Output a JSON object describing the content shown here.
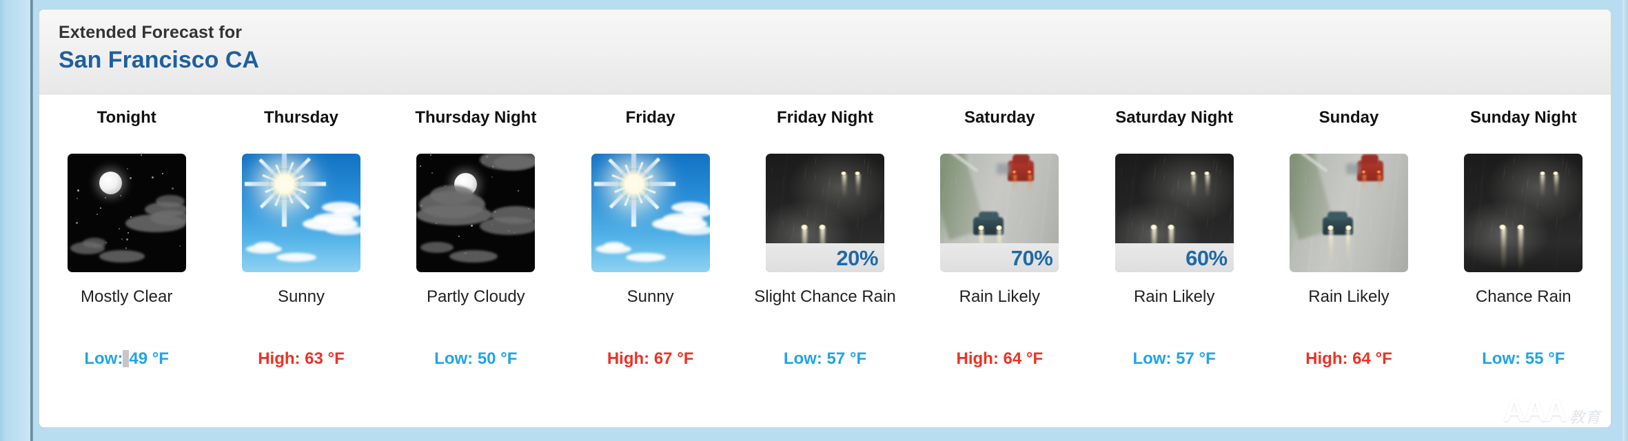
{
  "page": {
    "background_color": "#b8dcf0",
    "card_background": "#ffffff"
  },
  "header": {
    "eyebrow": "Extended Forecast for",
    "location": "San Francisco CA",
    "location_color": "#1f5f9e"
  },
  "colors": {
    "low_temp": "#1fa4e8",
    "high_temp": "#ee3124",
    "pop_badge": "#1f6aa5"
  },
  "watermark": {
    "text": "AAA",
    "subtext": "教育"
  },
  "forecast": [
    {
      "day": "Tonight",
      "icon": "moon-mostly-clear-icon",
      "icon_kind": "night-clear",
      "pop": null,
      "condition": "Mostly Clear",
      "temp_type": "Low",
      "temp_label": "Low:",
      "temp_value": "49 °F",
      "temp_full": "Low: 49 °F",
      "has_caret": true
    },
    {
      "day": "Thursday",
      "icon": "sun-sunny-icon",
      "icon_kind": "day-sunny",
      "pop": null,
      "condition": "Sunny",
      "temp_type": "High",
      "temp_label": "High:",
      "temp_value": "63 °F",
      "temp_full": "High: 63 °F",
      "has_caret": false
    },
    {
      "day": "Thursday Night",
      "icon": "moon-partly-cloudy-icon",
      "icon_kind": "night-partly-cloudy",
      "pop": null,
      "condition": "Partly Cloudy",
      "temp_type": "Low",
      "temp_label": "Low:",
      "temp_value": "50 °F",
      "temp_full": "Low: 50 °F",
      "has_caret": false
    },
    {
      "day": "Friday",
      "icon": "sun-sunny-icon",
      "icon_kind": "day-sunny",
      "pop": null,
      "condition": "Sunny",
      "temp_type": "High",
      "temp_label": "High:",
      "temp_value": "67 °F",
      "temp_full": "High: 67 °F",
      "has_caret": false
    },
    {
      "day": "Friday Night",
      "icon": "rain-night-icon",
      "icon_kind": "night-rain",
      "pop": "20%",
      "condition": "Slight Chance Rain",
      "temp_type": "Low",
      "temp_label": "Low:",
      "temp_value": "57 °F",
      "temp_full": "Low: 57 °F",
      "has_caret": false
    },
    {
      "day": "Saturday",
      "icon": "rain-day-icon",
      "icon_kind": "day-rain",
      "pop": "70%",
      "condition": "Rain Likely",
      "temp_type": "High",
      "temp_label": "High:",
      "temp_value": "64 °F",
      "temp_full": "High: 64 °F",
      "has_caret": false
    },
    {
      "day": "Saturday Night",
      "icon": "rain-night-icon",
      "icon_kind": "night-rain",
      "pop": "60%",
      "condition": "Rain Likely",
      "temp_type": "Low",
      "temp_label": "Low:",
      "temp_value": "57 °F",
      "temp_full": "Low: 57 °F",
      "has_caret": false
    },
    {
      "day": "Sunday",
      "icon": "rain-day-icon",
      "icon_kind": "day-rain",
      "pop": null,
      "condition": "Rain Likely",
      "temp_type": "High",
      "temp_label": "High:",
      "temp_value": "64 °F",
      "temp_full": "High: 64 °F",
      "has_caret": false
    },
    {
      "day": "Sunday Night",
      "icon": "rain-night-icon",
      "icon_kind": "night-rain",
      "pop": null,
      "condition": "Chance Rain",
      "temp_type": "Low",
      "temp_label": "Low:",
      "temp_value": "55 °F",
      "temp_full": "Low: 55 °F",
      "has_caret": false
    }
  ]
}
